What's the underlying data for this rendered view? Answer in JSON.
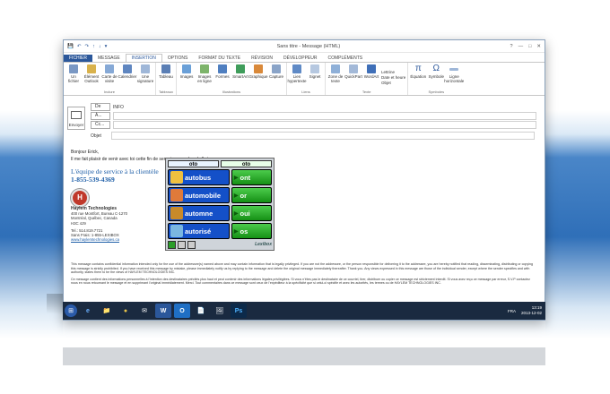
{
  "window": {
    "title": "Sans titre - Message (HTML)",
    "controls": [
      "?",
      "—",
      "□",
      "✕"
    ]
  },
  "quick_access": [
    "💾",
    "↶",
    "↷",
    "↑",
    "↓",
    "▾"
  ],
  "tabs": [
    "FICHIER",
    "MESSAGE",
    "INSERTION",
    "OPTIONS",
    "FORMAT DU TEXTE",
    "RÉVISION",
    "DÉVELOPPEUR",
    "COMPLÉMENTS"
  ],
  "active_tab": "INSERTION",
  "ribbon": {
    "groups": [
      {
        "name": "Inclure",
        "buttons": [
          "Un fichier",
          "Élément Outlook",
          "Carte de visite",
          "Calendrier",
          "Une signature"
        ]
      },
      {
        "name": "Tableaux",
        "buttons": [
          "Tableau"
        ]
      },
      {
        "name": "Illustrations",
        "buttons": [
          "Images",
          "Images en ligne",
          "Formes",
          "SmartArt",
          "Graphique",
          "Capture"
        ]
      },
      {
        "name": "Liens",
        "buttons": [
          "Lien hypertexte",
          "Signet"
        ]
      },
      {
        "name": "Texte",
        "buttons": [
          "Zone de texte",
          "QuickPart",
          "WordArt"
        ],
        "small": [
          "Lettrine",
          "Date et heure",
          "Objet"
        ]
      },
      {
        "name": "Symboles",
        "buttons": [
          "Équation",
          "Symbole",
          "Ligne horizontale"
        ]
      }
    ]
  },
  "header": {
    "send_label": "Envoyer",
    "from_label": "De",
    "from_value": "INFO",
    "to_label": "À...",
    "cc_label": "Cc...",
    "subject_label": "Objet"
  },
  "body": {
    "greeting": "Bonjour Erick,",
    "line": "Il me fait plaisir de venir avec toi cette fin de semaine au salon de l' oto",
    "team_title": "L'équipe de service à la clientèle",
    "phone": "1-855-539-4369",
    "logo_letter": "H",
    "company": "Haylem Technologies",
    "address": [
      "400 rue Montfort, Bureau C-1270",
      "Montréal, Québec, Canada",
      "H3C 4J9"
    ],
    "contact": [
      "Tel.: 514.819.7721",
      "Sans Frais: 1-855-LEXIBOX"
    ],
    "website": "www.haylemtechnologies.ca",
    "confidential_en": "This message contains confidential information intended only for the use of the addressee(s) named above and may contain information that is legally privileged. If you are not the addressee, or the person responsible for delivering it to the addressee, you are hereby notified that reading, disseminating, distributing or copying this message is strictly prohibited. If you have received this message by mistake, please immediately notify us by replying to the message and delete the original message immediately thereafter. Thank you. Any views expressed in this message are those of the individual sender, except where the sender specifies and with authority, states them to be the views of HAYLEM TECHNOLOGIES INC.",
    "confidential_fr": "Ce message contient des informations personnelles à l'intention des destinataires précités plus haut et peut contenir des informations légales privilégiées. Si vous n'êtes pas le destinataire de ce courriel, tirer, distribuer ou copier ce message est strictement interdit. Si vous avez reçu ce message par erreur, S.V.P contactez nous en nous retournant le message et en supprimant l'original immédiatement. Merci. Tout commentaires dans ce message sont ceux de l'expéditeur à la spécificité que si celui-ci spécifie et avec les autorités, les termes ou de HAYLEM TECHNOLOGIES INC."
  },
  "predictor": {
    "input_left": "oto",
    "input_right": "oto",
    "words": [
      "autobus",
      "automobile",
      "automne",
      "autorisé"
    ],
    "suffixes": [
      "ont",
      "or",
      "oui",
      "os"
    ],
    "brand": "Lexibox"
  },
  "taskbar": {
    "apps": [
      "⊞",
      "e",
      "📁",
      "●",
      "✉",
      "W",
      "O",
      "📄",
      "🖼",
      "Ps"
    ],
    "tray_lang": "FRA",
    "time": "13:19",
    "date": "2013-12-02"
  }
}
